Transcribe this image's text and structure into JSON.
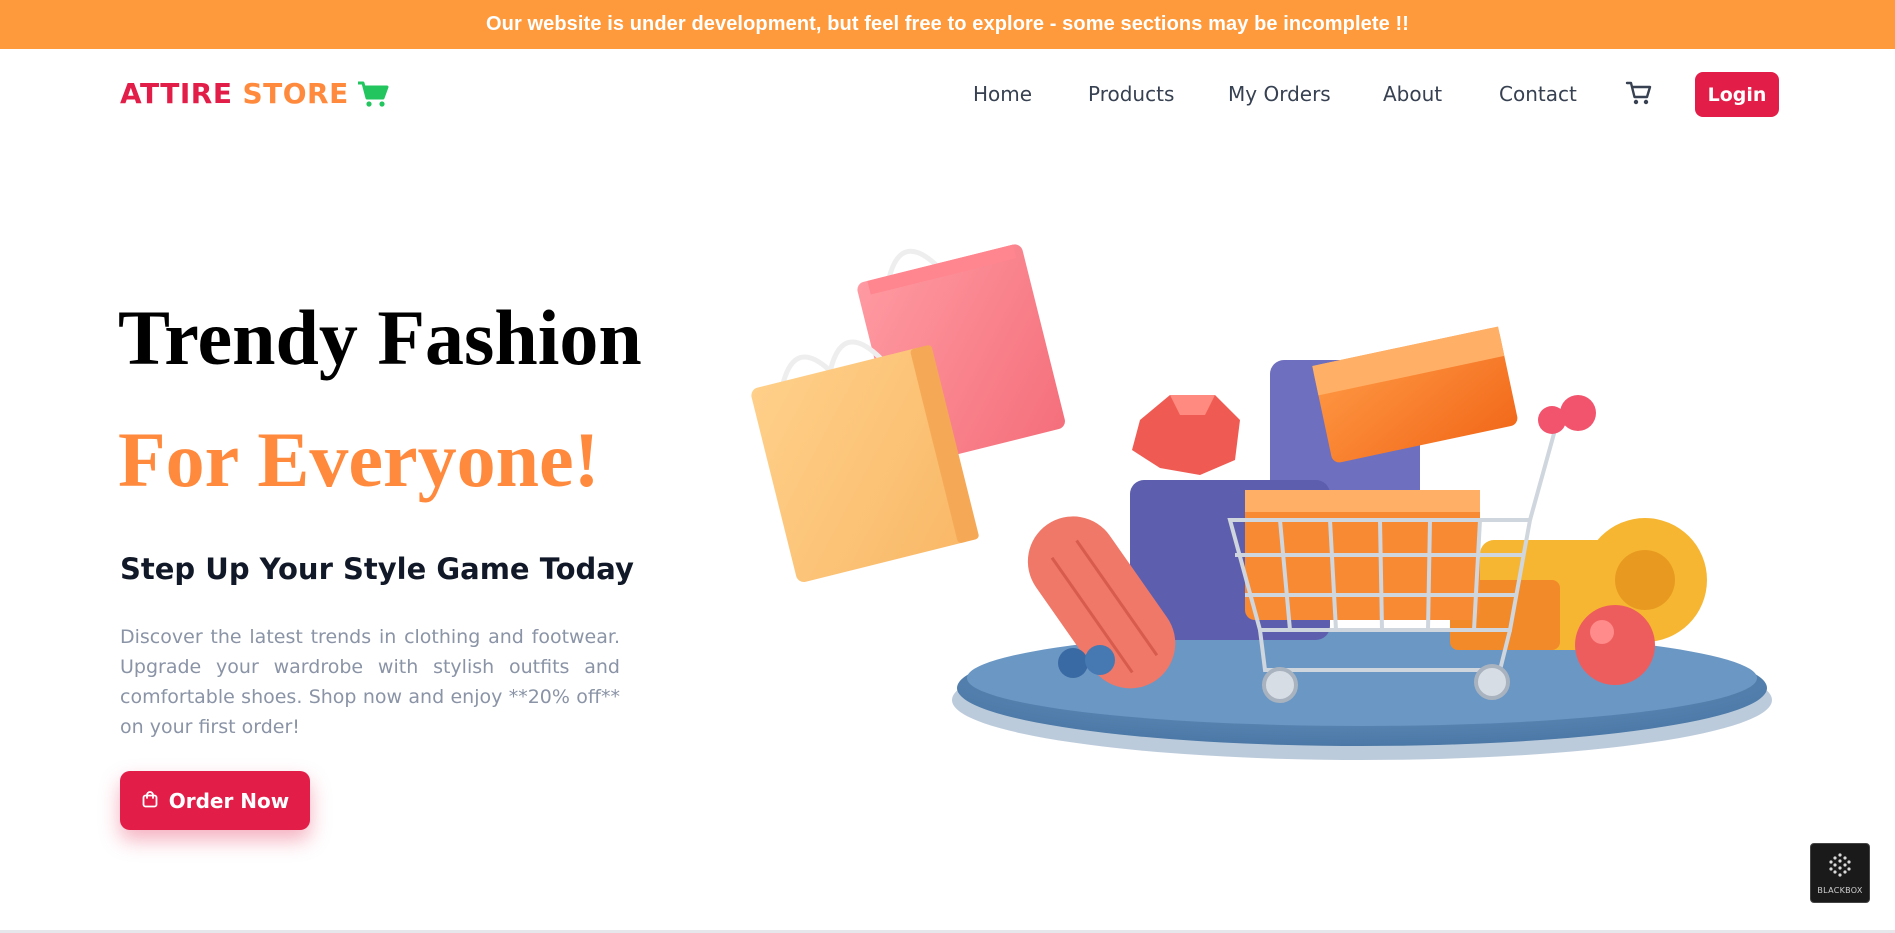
{
  "banner": {
    "text": "Our website is under development, but feel free to explore - some sections may be incomplete !!"
  },
  "navbar": {
    "logo_word1": "ATTIRE",
    "logo_word2": "STORE",
    "links": [
      {
        "label": "Home"
      },
      {
        "label": "Products"
      },
      {
        "label": "My Orders"
      },
      {
        "label": "About"
      },
      {
        "label": "Contact"
      }
    ],
    "login_label": "Login"
  },
  "hero": {
    "title_line1": "Trendy Fashion",
    "title_line2": "For Everyone!",
    "subtitle": "Step Up Your Style Game Today",
    "description": "Discover the latest trends in clothing and footwear. Upgrade your wardrobe with stylish outfits and comfortable shoes. Shop now and enjoy **20% off** on your first order!",
    "cta_label": "Order Now"
  },
  "badge": {
    "text": "BLACKBOX"
  },
  "colors": {
    "banner": "#ff9a3c",
    "brand_red": "#e11d48",
    "brand_orange": "#ff8a3d",
    "cart_green": "#22c55e"
  }
}
